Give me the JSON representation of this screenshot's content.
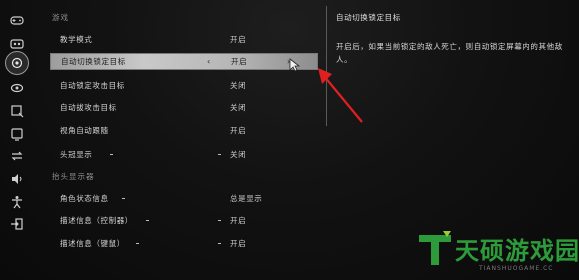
{
  "rail": {
    "icons": [
      {
        "name": "gamepad-icon"
      },
      {
        "name": "controller-icon"
      },
      {
        "name": "target-icon",
        "active": true
      },
      {
        "name": "eye-icon"
      },
      {
        "name": "hud-icon"
      },
      {
        "name": "display-icon"
      },
      {
        "name": "swap-icon"
      },
      {
        "name": "audio-icon"
      },
      {
        "name": "accessibility-icon"
      },
      {
        "name": "exit-icon"
      }
    ]
  },
  "settings": {
    "section_game": "游戏",
    "rows_game": [
      {
        "label": "教学模式",
        "value": "开启"
      },
      {
        "label": "自动切换锁定目标",
        "value": "开启",
        "selected": true
      },
      {
        "label": "自动锁定攻击目标",
        "value": "关闭"
      },
      {
        "label": "自动拔攻击目标",
        "value": "关闭"
      },
      {
        "label": "视角自动跟随",
        "value": "开启"
      },
      {
        "label": "头冠显示",
        "value": "关闭"
      }
    ],
    "section_hud": "抬头显示器",
    "rows_hud": [
      {
        "label": "角色状态信息",
        "value": "总是显示"
      },
      {
        "label": "描述信息（控制器）",
        "value": "开启"
      },
      {
        "label": "描述信息（键鼠）",
        "value": "开启"
      }
    ],
    "chevron_left": "‹",
    "chevron_right": "›"
  },
  "description": {
    "title": "自动切换锁定目标",
    "body": "开启后，如果当前锁定的敌人死亡，则自动锁定屏幕内的其他敌人。"
  },
  "watermark": {
    "name": "天硕游戏园",
    "url": "TIANSHUOGAME.CC"
  },
  "colors": {
    "selected_row": "#bcbcbc",
    "arrow": "#e02020",
    "watermark_green": "#2e9b3a"
  }
}
